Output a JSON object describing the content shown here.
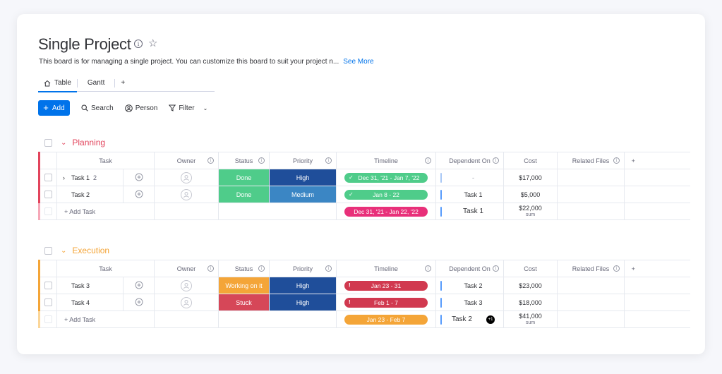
{
  "board": {
    "title": "Single Project",
    "description": "This board is for managing a single project. You can customize this board to suit your project n...",
    "see_more": "See More"
  },
  "tabs": [
    {
      "label": "Table",
      "active": true
    },
    {
      "label": "Gantt",
      "active": false
    },
    {
      "label": "+",
      "active": false
    }
  ],
  "toolbar": {
    "add_label": "Add",
    "search_label": "Search",
    "person_label": "Person",
    "filter_label": "Filter"
  },
  "columns": {
    "task": "Task",
    "owner": "Owner",
    "status": "Status",
    "priority": "Priority",
    "timeline": "Timeline",
    "dependent_on": "Dependent On",
    "cost": "Cost",
    "related_files": "Related Files",
    "add_column": "+"
  },
  "colors": {
    "accent": "#0073ea",
    "planning": "#e2445c",
    "execution": "#fdab3d",
    "done": "#00c875",
    "working": "#fdab3d",
    "stuck": "#e2445c",
    "high": "#401694",
    "medium": "#5559df",
    "timeline_green": "#00c875",
    "timeline_pink": "#e2445c",
    "timeline_red": "#d83a52",
    "timeline_orange": "#fdab3d"
  },
  "groups": [
    {
      "name": "Planning",
      "color": "#e2445c",
      "rows": [
        {
          "task": "Task 1",
          "subitems": "2",
          "status": "Done",
          "status_color": "#4fcc8a",
          "priority": "High",
          "priority_color": "#1f4e9a",
          "timeline": "Dec 31, '21 - Jan 7, '22",
          "timeline_color": "#4fcc8a",
          "timeline_mark": "✓",
          "dependent_on": "-",
          "cost": "$17,000"
        },
        {
          "task": "Task 2",
          "subitems": "",
          "status": "Done",
          "status_color": "#4fcc8a",
          "priority": "Medium",
          "priority_color": "#3b86c4",
          "timeline": "Jan 8 - 22",
          "timeline_color": "#4fcc8a",
          "timeline_mark": "✓",
          "dependent_on": "Task 1",
          "cost": "$5,000"
        }
      ],
      "add_task": "+ Add Task",
      "summary": {
        "timeline": "Dec 31, '21 - Jan 22, '22",
        "timeline_color": "#e8307a",
        "dependent_on": "Task 1",
        "cost": "$22,000",
        "cost_label": "sum"
      }
    },
    {
      "name": "Execution",
      "color": "#f4a538",
      "rows": [
        {
          "task": "Task 3",
          "subitems": "",
          "status": "Working on it",
          "status_color": "#f4a538",
          "priority": "High",
          "priority_color": "#1f4e9a",
          "timeline": "Jan 23 - 31",
          "timeline_color": "#d1394f",
          "timeline_mark": "!",
          "dependent_on": "Task 2",
          "cost": "$23,000"
        },
        {
          "task": "Task 4",
          "subitems": "",
          "status": "Stuck",
          "status_color": "#d64758",
          "priority": "High",
          "priority_color": "#1f4e9a",
          "timeline": "Feb 1 - 7",
          "timeline_color": "#d1394f",
          "timeline_mark": "!",
          "dependent_on": "Task 3",
          "cost": "$18,000"
        }
      ],
      "add_task": "+ Add Task",
      "summary": {
        "timeline": "Jan 23 - Feb 7",
        "timeline_color": "#f4a538",
        "dependent_on": "Task 2",
        "dependent_extra": "+1",
        "cost": "$41,000",
        "cost_label": "sum"
      }
    }
  ]
}
